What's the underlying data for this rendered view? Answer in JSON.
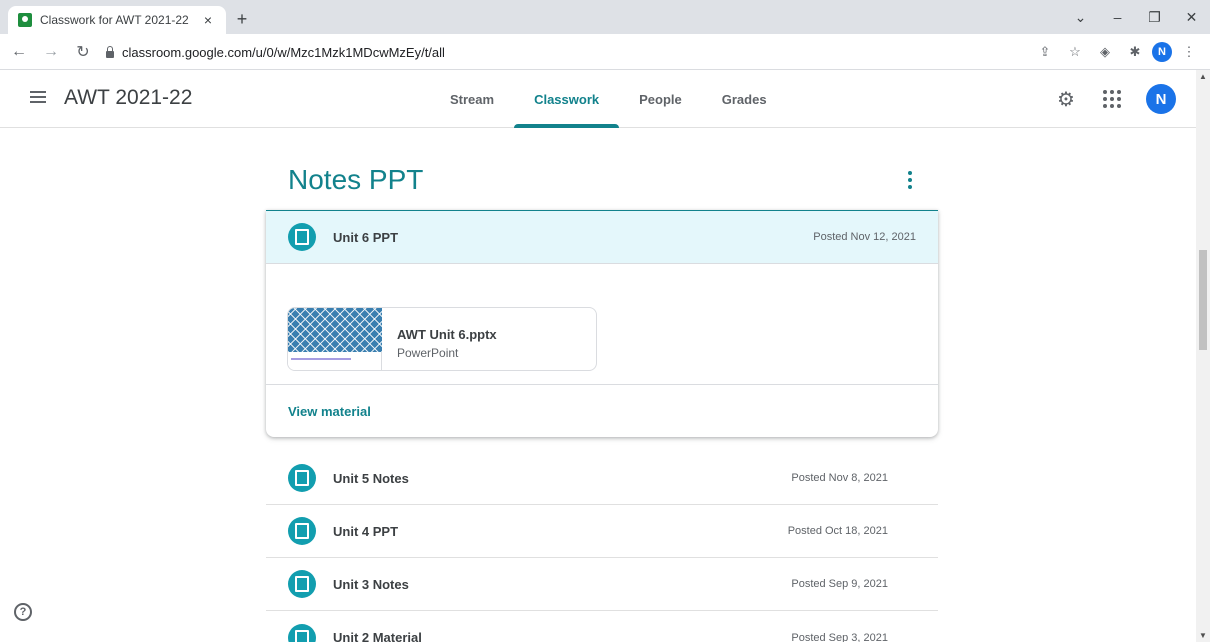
{
  "browser": {
    "tab_title": "Classwork for AWT 2021-22",
    "tab_close": "×",
    "new_tab": "+",
    "url": "classroom.google.com/u/0/w/Mzc1Mzk1MDcwMzEy/t/all",
    "profile_initial": "N",
    "window_controls": [
      "⌄",
      "–",
      "❐",
      "✕"
    ]
  },
  "header": {
    "class_name": "AWT 2021-22",
    "tabs": [
      {
        "label": "Stream",
        "active": false
      },
      {
        "label": "Classwork",
        "active": true
      },
      {
        "label": "People",
        "active": false
      },
      {
        "label": "Grades",
        "active": false
      }
    ],
    "avatar_initial": "N"
  },
  "topic": {
    "title": "Notes PPT",
    "expanded_item": {
      "title": "Unit 6 PPT",
      "date": "Posted Nov 12, 2021",
      "attachment": {
        "name": "AWT Unit 6.pptx",
        "type": "PowerPoint"
      },
      "view_label": "View material"
    },
    "items": [
      {
        "title": "Unit 5 Notes",
        "date": "Posted Nov 8, 2021"
      },
      {
        "title": "Unit 4 PPT",
        "date": "Posted Oct 18, 2021"
      },
      {
        "title": "Unit 3 Notes",
        "date": "Posted Sep 9, 2021"
      },
      {
        "title": "Unit 2 Material",
        "date": "Posted Sep 3, 2021"
      }
    ]
  },
  "colors": {
    "accent": "#12828c",
    "icon_bg": "#129eaf",
    "expanded_bg": "#e4f7fb"
  }
}
